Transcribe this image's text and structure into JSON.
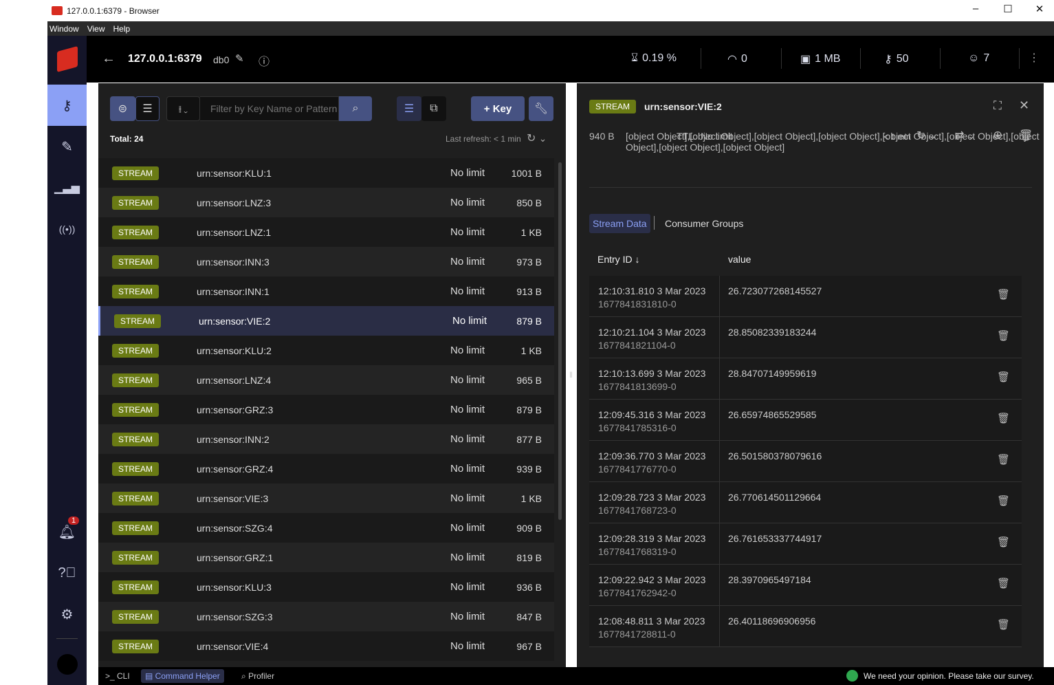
{
  "window": {
    "title": "127.0.0.1:6379 - Browser",
    "menu": [
      "Window",
      "View",
      "Help"
    ]
  },
  "header": {
    "host": "127.0.0.1:6379",
    "db": "db0",
    "stats": {
      "cpu": "0.19 %",
      "ops": "0",
      "memory": "1 MB",
      "keys": "50",
      "clients": "7"
    }
  },
  "sidebar": {
    "notification_count": "1"
  },
  "browser": {
    "filter_placeholder": "Filter by Key Name or Pattern",
    "add_key": "+ Key",
    "total": "Total: 24",
    "last_refresh": "Last refresh: < 1 min",
    "keys": [
      {
        "type": "STREAM",
        "name": "urn:sensor:KLU:1",
        "ttl": "No limit",
        "size": "1001 B"
      },
      {
        "type": "STREAM",
        "name": "urn:sensor:LNZ:3",
        "ttl": "No limit",
        "size": "850 B"
      },
      {
        "type": "STREAM",
        "name": "urn:sensor:LNZ:1",
        "ttl": "No limit",
        "size": "1 KB"
      },
      {
        "type": "STREAM",
        "name": "urn:sensor:INN:3",
        "ttl": "No limit",
        "size": "973 B"
      },
      {
        "type": "STREAM",
        "name": "urn:sensor:INN:1",
        "ttl": "No limit",
        "size": "913 B"
      },
      {
        "type": "STREAM",
        "name": "urn:sensor:VIE:2",
        "ttl": "No limit",
        "size": "879 B",
        "selected": true
      },
      {
        "type": "STREAM",
        "name": "urn:sensor:KLU:2",
        "ttl": "No limit",
        "size": "1 KB"
      },
      {
        "type": "STREAM",
        "name": "urn:sensor:LNZ:4",
        "ttl": "No limit",
        "size": "965 B"
      },
      {
        "type": "STREAM",
        "name": "urn:sensor:GRZ:3",
        "ttl": "No limit",
        "size": "879 B"
      },
      {
        "type": "STREAM",
        "name": "urn:sensor:INN:2",
        "ttl": "No limit",
        "size": "877 B"
      },
      {
        "type": "STREAM",
        "name": "urn:sensor:GRZ:4",
        "ttl": "No limit",
        "size": "939 B"
      },
      {
        "type": "STREAM",
        "name": "urn:sensor:VIE:3",
        "ttl": "No limit",
        "size": "1 KB"
      },
      {
        "type": "STREAM",
        "name": "urn:sensor:SZG:4",
        "ttl": "No limit",
        "size": "909 B"
      },
      {
        "type": "STREAM",
        "name": "urn:sensor:GRZ:1",
        "ttl": "No limit",
        "size": "819 B"
      },
      {
        "type": "STREAM",
        "name": "urn:sensor:KLU:3",
        "ttl": "No limit",
        "size": "936 B"
      },
      {
        "type": "STREAM",
        "name": "urn:sensor:SZG:3",
        "ttl": "No limit",
        "size": "847 B"
      },
      {
        "type": "STREAM",
        "name": "urn:sensor:VIE:4",
        "ttl": "No limit",
        "size": "967 B"
      }
    ]
  },
  "details": {
    "type": "STREAM",
    "name": "urn:sensor:VIE:2",
    "size": "940 B",
    "entries": [
      {
        "time": "12:10:31.810 3 Mar 2023",
        "id": "1677841831810-0",
        "value": "26.723077268145527"
      },
      {
        "time": "12:10:21.104 3 Mar 2023",
        "id": "1677841821104-0",
        "value": "28.85082339183244"
      },
      {
        "time": "12:10:13.699 3 Mar 2023",
        "id": "1677841813699-0",
        "value": "28.84707149959619"
      },
      {
        "time": "12:09:45.316 3 Mar 2023",
        "id": "1677841785316-0",
        "value": "26.65974865529585"
      },
      {
        "time": "12:09:36.770 3 Mar 2023",
        "id": "1677841776770-0",
        "value": "26.501580378079616"
      },
      {
        "time": "12:09:28.723 3 Mar 2023",
        "id": "1677841768723-0",
        "value": "26.770614501129664"
      },
      {
        "time": "12:09:28.319 3 Mar 2023",
        "id": "1677841768319-0",
        "value": "26.761653337744917"
      },
      {
        "time": "12:09:22.942 3 Mar 2023",
        "id": "1677841762942-0",
        "value": "28.3970965497184"
      },
      {
        "time": "12:08:48.811 3 Mar 2023",
        "id": "1677841728811-0",
        "value": "26.40118696906956"
      }
    ],
    "ttl_label": "TTL:",
    "ttl": "No limit",
    "refresh": "< 1 min",
    "tabs": [
      "Stream Data",
      "Consumer Groups"
    ],
    "columns": [
      "Entry ID",
      "value"
    ]
  },
  "bottom": {
    "cli": "CLI",
    "command_helper": "Command Helper",
    "profiler": "Profiler",
    "survey": "We need your opinion. Please take our survey."
  },
  "colors": {
    "accent": "#8ba0f5",
    "stream_badge": "#6a7b14",
    "button": "#465282"
  }
}
